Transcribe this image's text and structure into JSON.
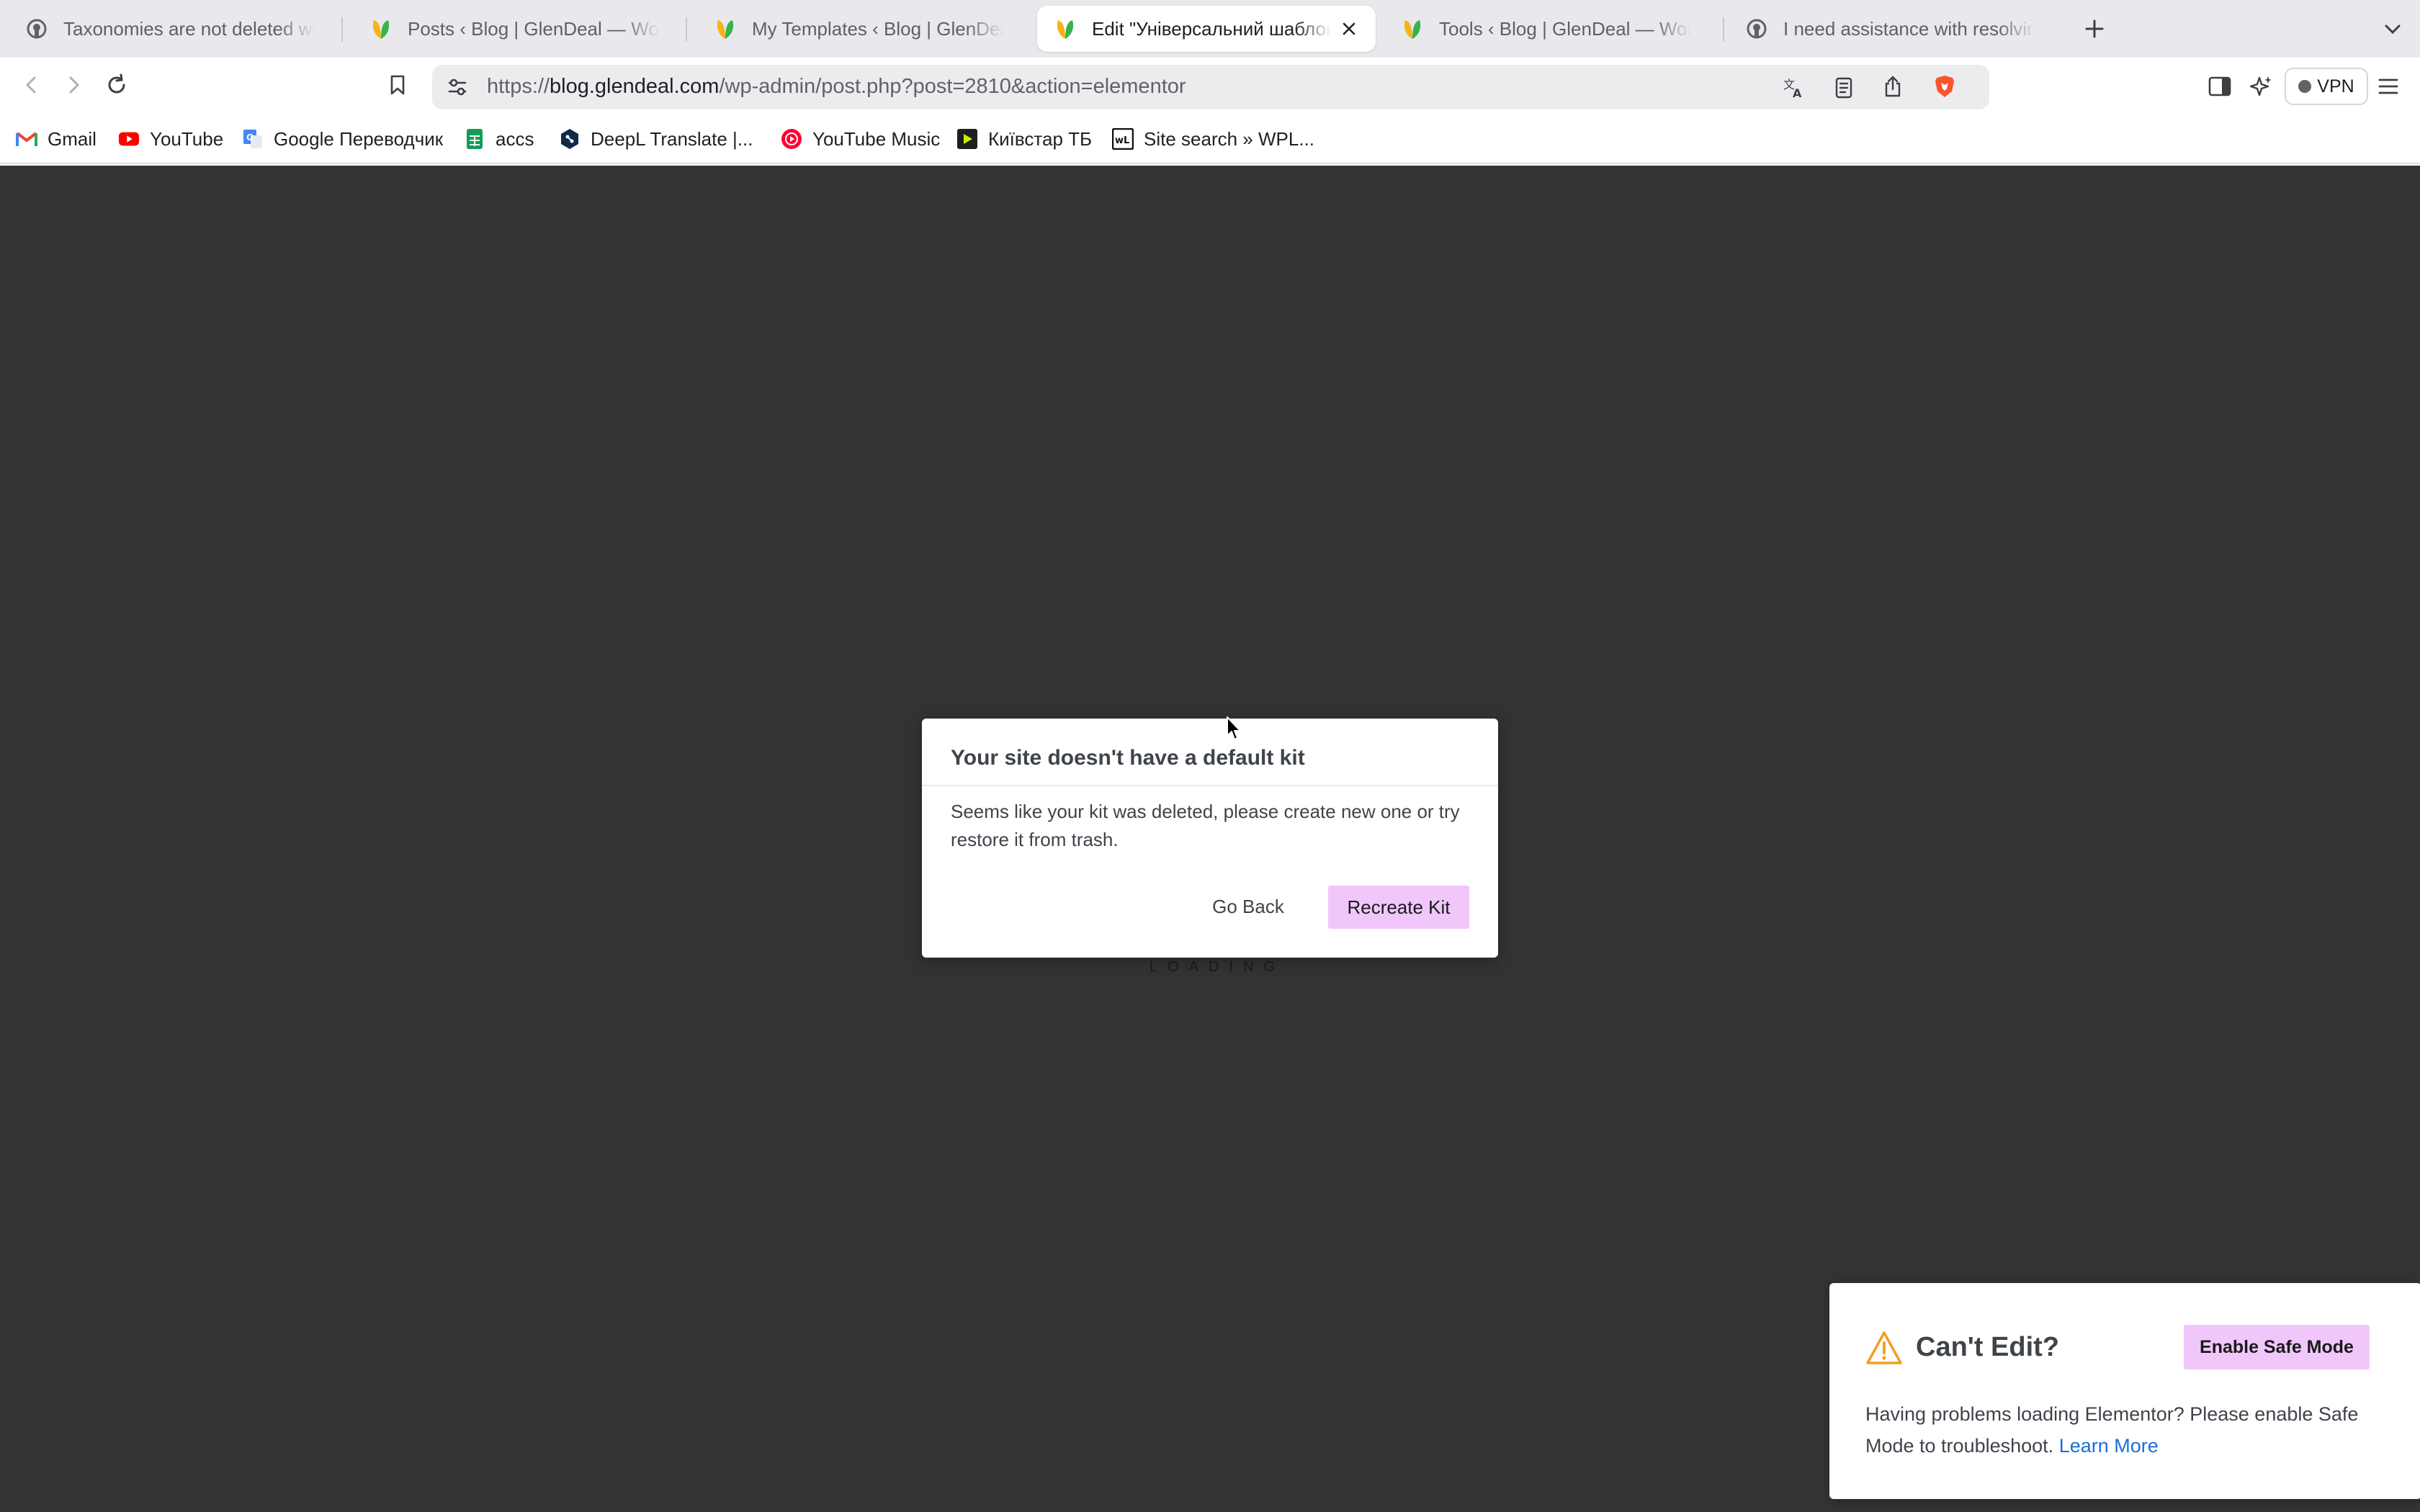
{
  "browser": {
    "tabs": [
      {
        "title": "Taxonomies are not deleted with t",
        "icon": "github-icon",
        "active": false
      },
      {
        "title": "Posts ‹ Blog | GlenDeal — WordPr",
        "icon": "glendeal-leaf-icon",
        "active": false
      },
      {
        "title": "My Templates ‹ Blog | GlenDeal —",
        "icon": "glendeal-leaf-icon",
        "active": false
      },
      {
        "title": "Edit \"Універсальний шаблон",
        "icon": "glendeal-leaf-icon",
        "active": true
      },
      {
        "title": "Tools ‹ Blog | GlenDeal — WordPr",
        "icon": "glendeal-leaf-icon",
        "active": false
      },
      {
        "title": "I need assistance with resolving i",
        "icon": "github-icon",
        "active": false
      }
    ],
    "url": {
      "scheme": "https://",
      "host": "blog.glendeal.com",
      "path": "/wp-admin/post.php?post=2810&action=elementor"
    },
    "vpn_label": "VPN",
    "bookmarks": [
      {
        "label": "Gmail",
        "icon": "gmail-icon"
      },
      {
        "label": "YouTube",
        "icon": "youtube-icon"
      },
      {
        "label": "Google Переводчик",
        "icon": "google-translate-icon"
      },
      {
        "label": "accs",
        "icon": "sheets-icon"
      },
      {
        "label": "DeepL Translate |...",
        "icon": "deepl-icon"
      },
      {
        "label": "YouTube Music",
        "icon": "youtube-music-icon"
      },
      {
        "label": "Київстар ТБ",
        "icon": "kyivstar-icon"
      },
      {
        "label": "Site search » WPL...",
        "icon": "wpl-icon"
      }
    ]
  },
  "page": {
    "loading_text": "LOADING",
    "dialog": {
      "title": "Your site doesn't have a default kit",
      "message": "Seems like your kit was deleted, please create new one or try restore it from trash.",
      "secondary_button": "Go Back",
      "primary_button": "Recreate Kit"
    },
    "safe_mode_notice": {
      "title": "Can't Edit?",
      "button": "Enable Safe Mode",
      "message": "Having problems loading Elementor? Please enable Safe Mode to troubleshoot.",
      "link": "Learn More"
    }
  },
  "colors": {
    "accent_button": "#f1c7fb",
    "editor_background": "#333333",
    "link": "#1a6fd8",
    "warning_icon": "#f0a020"
  }
}
